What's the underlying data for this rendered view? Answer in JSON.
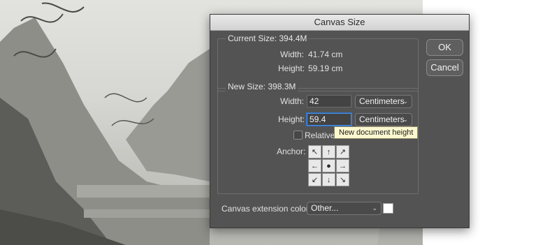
{
  "dialog": {
    "title": "Canvas Size",
    "ok_label": "OK",
    "cancel_label": "Cancel"
  },
  "current_size": {
    "label": "Current Size: 394.4M",
    "width_label": "Width:",
    "width_value": "41.74 cm",
    "height_label": "Height:",
    "height_value": "59.19 cm"
  },
  "new_size": {
    "label": "New Size: 398.3M",
    "width_label": "Width:",
    "width_value": "42",
    "width_unit": "Centimeters",
    "height_label": "Height:",
    "height_value": "59.4",
    "height_unit": "Centimeters",
    "relative_label": "Relative",
    "relative_checked": false,
    "anchor_label": "Anchor:",
    "tooltip": "New document height"
  },
  "extension": {
    "label": "Canvas extension color:",
    "value": "Other...",
    "swatch_color": "#ffffff"
  },
  "anchor_icons": [
    "arrow-nw-icon",
    "arrow-n-icon",
    "arrow-ne-icon",
    "arrow-w-icon",
    "center-dot-icon",
    "arrow-e-icon",
    "arrow-sw-icon",
    "arrow-s-icon",
    "arrow-se-icon"
  ]
}
